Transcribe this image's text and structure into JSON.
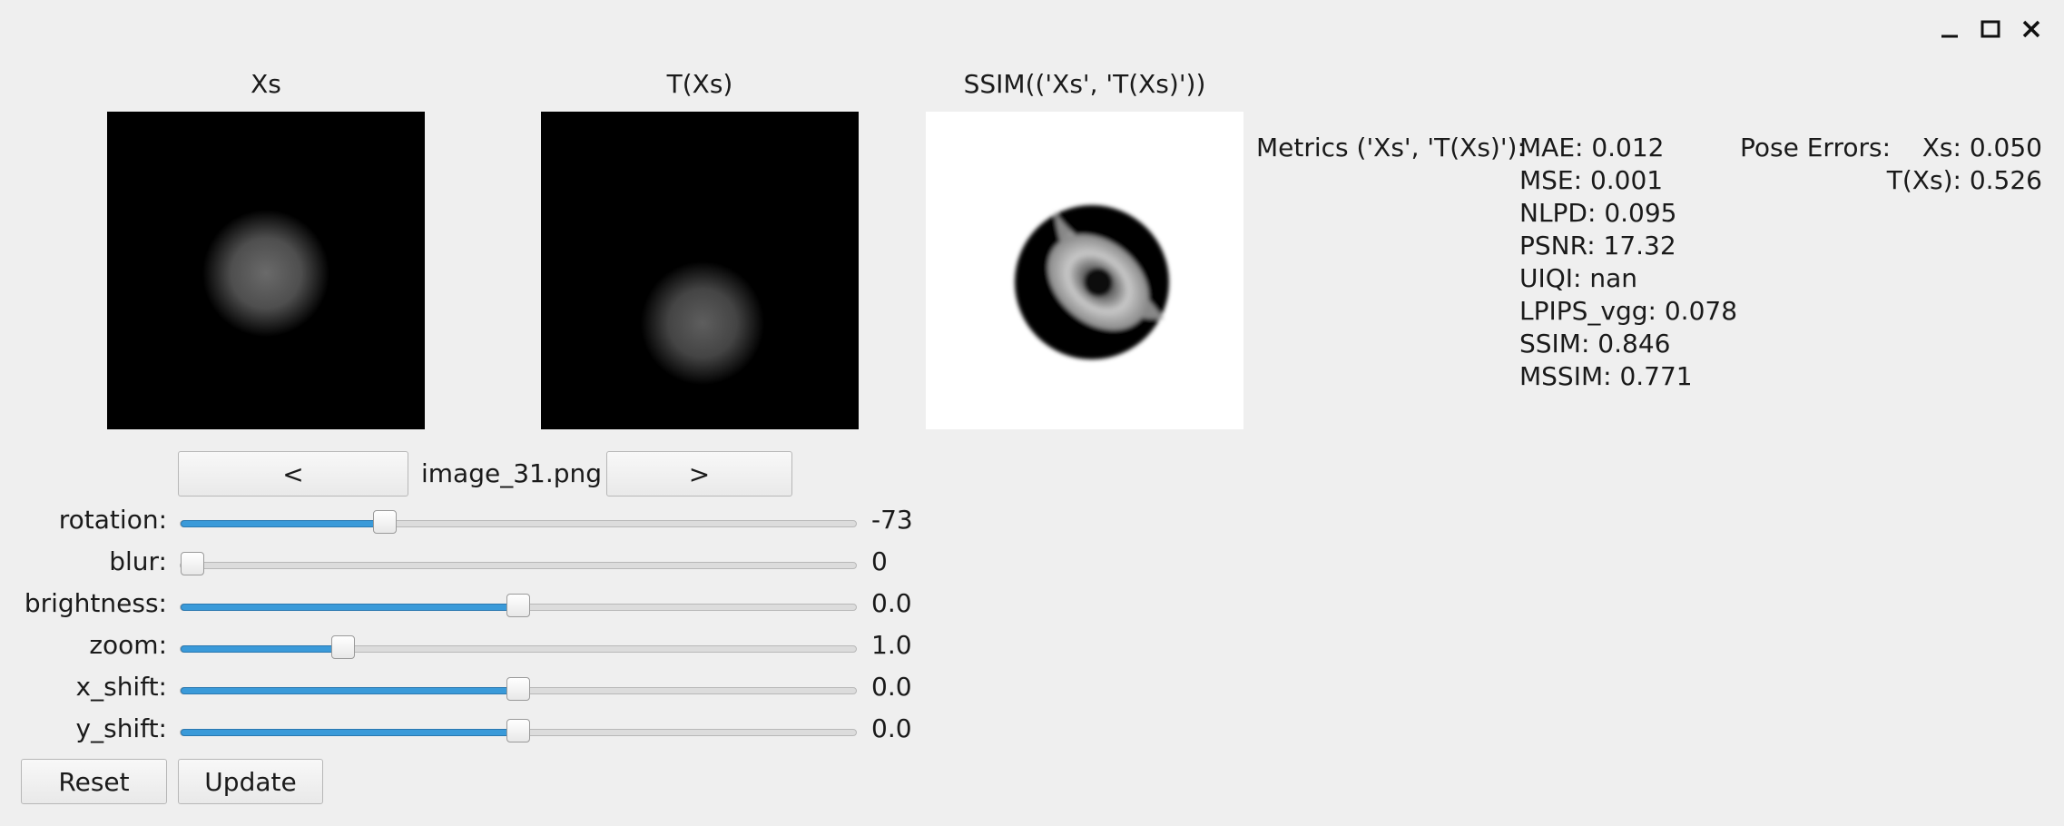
{
  "window_controls": {
    "minimize": "minimize-icon",
    "maximize": "maximize-icon",
    "close": "close-icon"
  },
  "images": [
    {
      "title": "Xs"
    },
    {
      "title": "T(Xs)"
    },
    {
      "title": "SSIM(('Xs', 'T(Xs)'))"
    }
  ],
  "metrics": {
    "header": "Metrics ('Xs', 'T(Xs)'):",
    "values": [
      "MAE: 0.012",
      "MSE: 0.001",
      "NLPD: 0.095",
      "PSNR: 17.32",
      "UIQI: nan",
      "LPIPS_vgg: 0.078",
      "SSIM: 0.846",
      "MSSIM: 0.771"
    ]
  },
  "pose_errors": {
    "header": "Pose Errors:",
    "values": [
      "Xs: 0.050",
      "T(Xs): 0.526"
    ]
  },
  "nav": {
    "prev_label": "<",
    "filename": "image_31.png",
    "next_label": ">"
  },
  "sliders": [
    {
      "label": "rotation:",
      "value": "-73",
      "level": 0.303
    },
    {
      "label": "blur:",
      "value": "0",
      "level": 0.0
    },
    {
      "label": "brightness:",
      "value": "0.0",
      "level": 0.5
    },
    {
      "label": "zoom:",
      "value": "1.0",
      "level": 0.24
    },
    {
      "label": "x_shift:",
      "value": "0.0",
      "level": 0.5
    },
    {
      "label": "y_shift:",
      "value": "0.0",
      "level": 0.5
    }
  ],
  "buttons": {
    "reset_label": "Reset",
    "update_label": "Update"
  },
  "colors": {
    "accent": "#3a9ad9",
    "background": "#efefef"
  }
}
